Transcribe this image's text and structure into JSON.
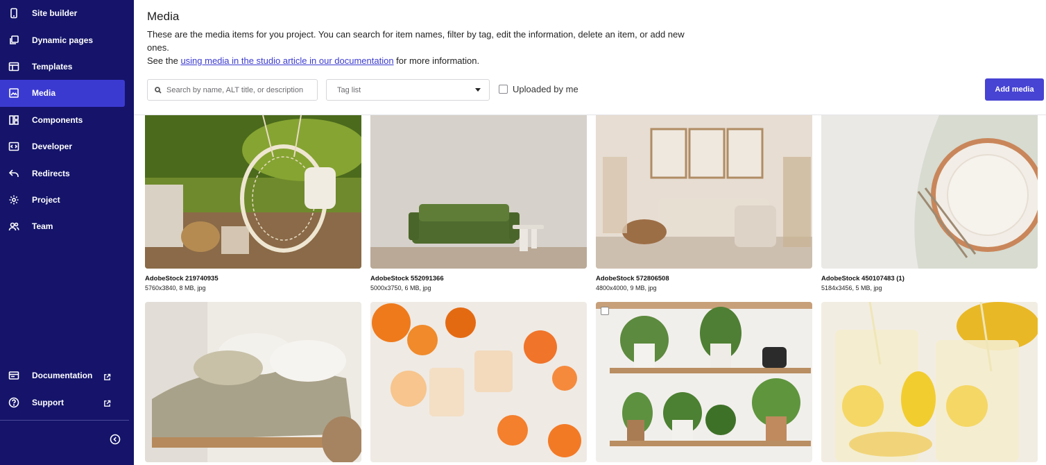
{
  "sidebar": {
    "items": [
      {
        "label": "Site builder",
        "icon": "phone-icon"
      },
      {
        "label": "Dynamic pages",
        "icon": "pages-icon"
      },
      {
        "label": "Templates",
        "icon": "template-icon"
      },
      {
        "label": "Media",
        "icon": "image-icon",
        "active": true
      },
      {
        "label": "Components",
        "icon": "components-icon"
      },
      {
        "label": "Developer",
        "icon": "code-icon"
      },
      {
        "label": "Redirects",
        "icon": "redirect-icon"
      },
      {
        "label": "Project",
        "icon": "gear-icon"
      },
      {
        "label": "Team",
        "icon": "team-icon"
      }
    ],
    "bottom_items": [
      {
        "label": "Documentation",
        "icon": "documentation-icon"
      },
      {
        "label": "Support",
        "icon": "help-icon"
      }
    ]
  },
  "header": {
    "title": "Media",
    "desc_line1": "These are the media items for you project. You can search for item names, filter by tag, edit the information, delete an item, or add new ones.",
    "desc_see": "See the ",
    "desc_link": "using media in the studio article in our documentation",
    "desc_after": " for more information."
  },
  "toolbar": {
    "search_placeholder": "Search by name, ALT title, or description",
    "tag_placeholder": "Tag list",
    "uploaded_label": "Uploaded by me",
    "add_label": "Add media"
  },
  "media": [
    {
      "name": "AdobeStock 219740935",
      "meta": "5760x3840, 8 MB, jpg"
    },
    {
      "name": "AdobeStock 552091366",
      "meta": "5000x3750, 6 MB, jpg"
    },
    {
      "name": "AdobeStock 572806508",
      "meta": "4800x4000, 9 MB, jpg"
    },
    {
      "name": "AdobeStock 450107483 (1)",
      "meta": "5184x3456, 5 MB, jpg"
    }
  ],
  "colors": {
    "sidebar_bg": "#15146a",
    "active_bg": "#3b3ad0",
    "accent": "#4743d3"
  }
}
